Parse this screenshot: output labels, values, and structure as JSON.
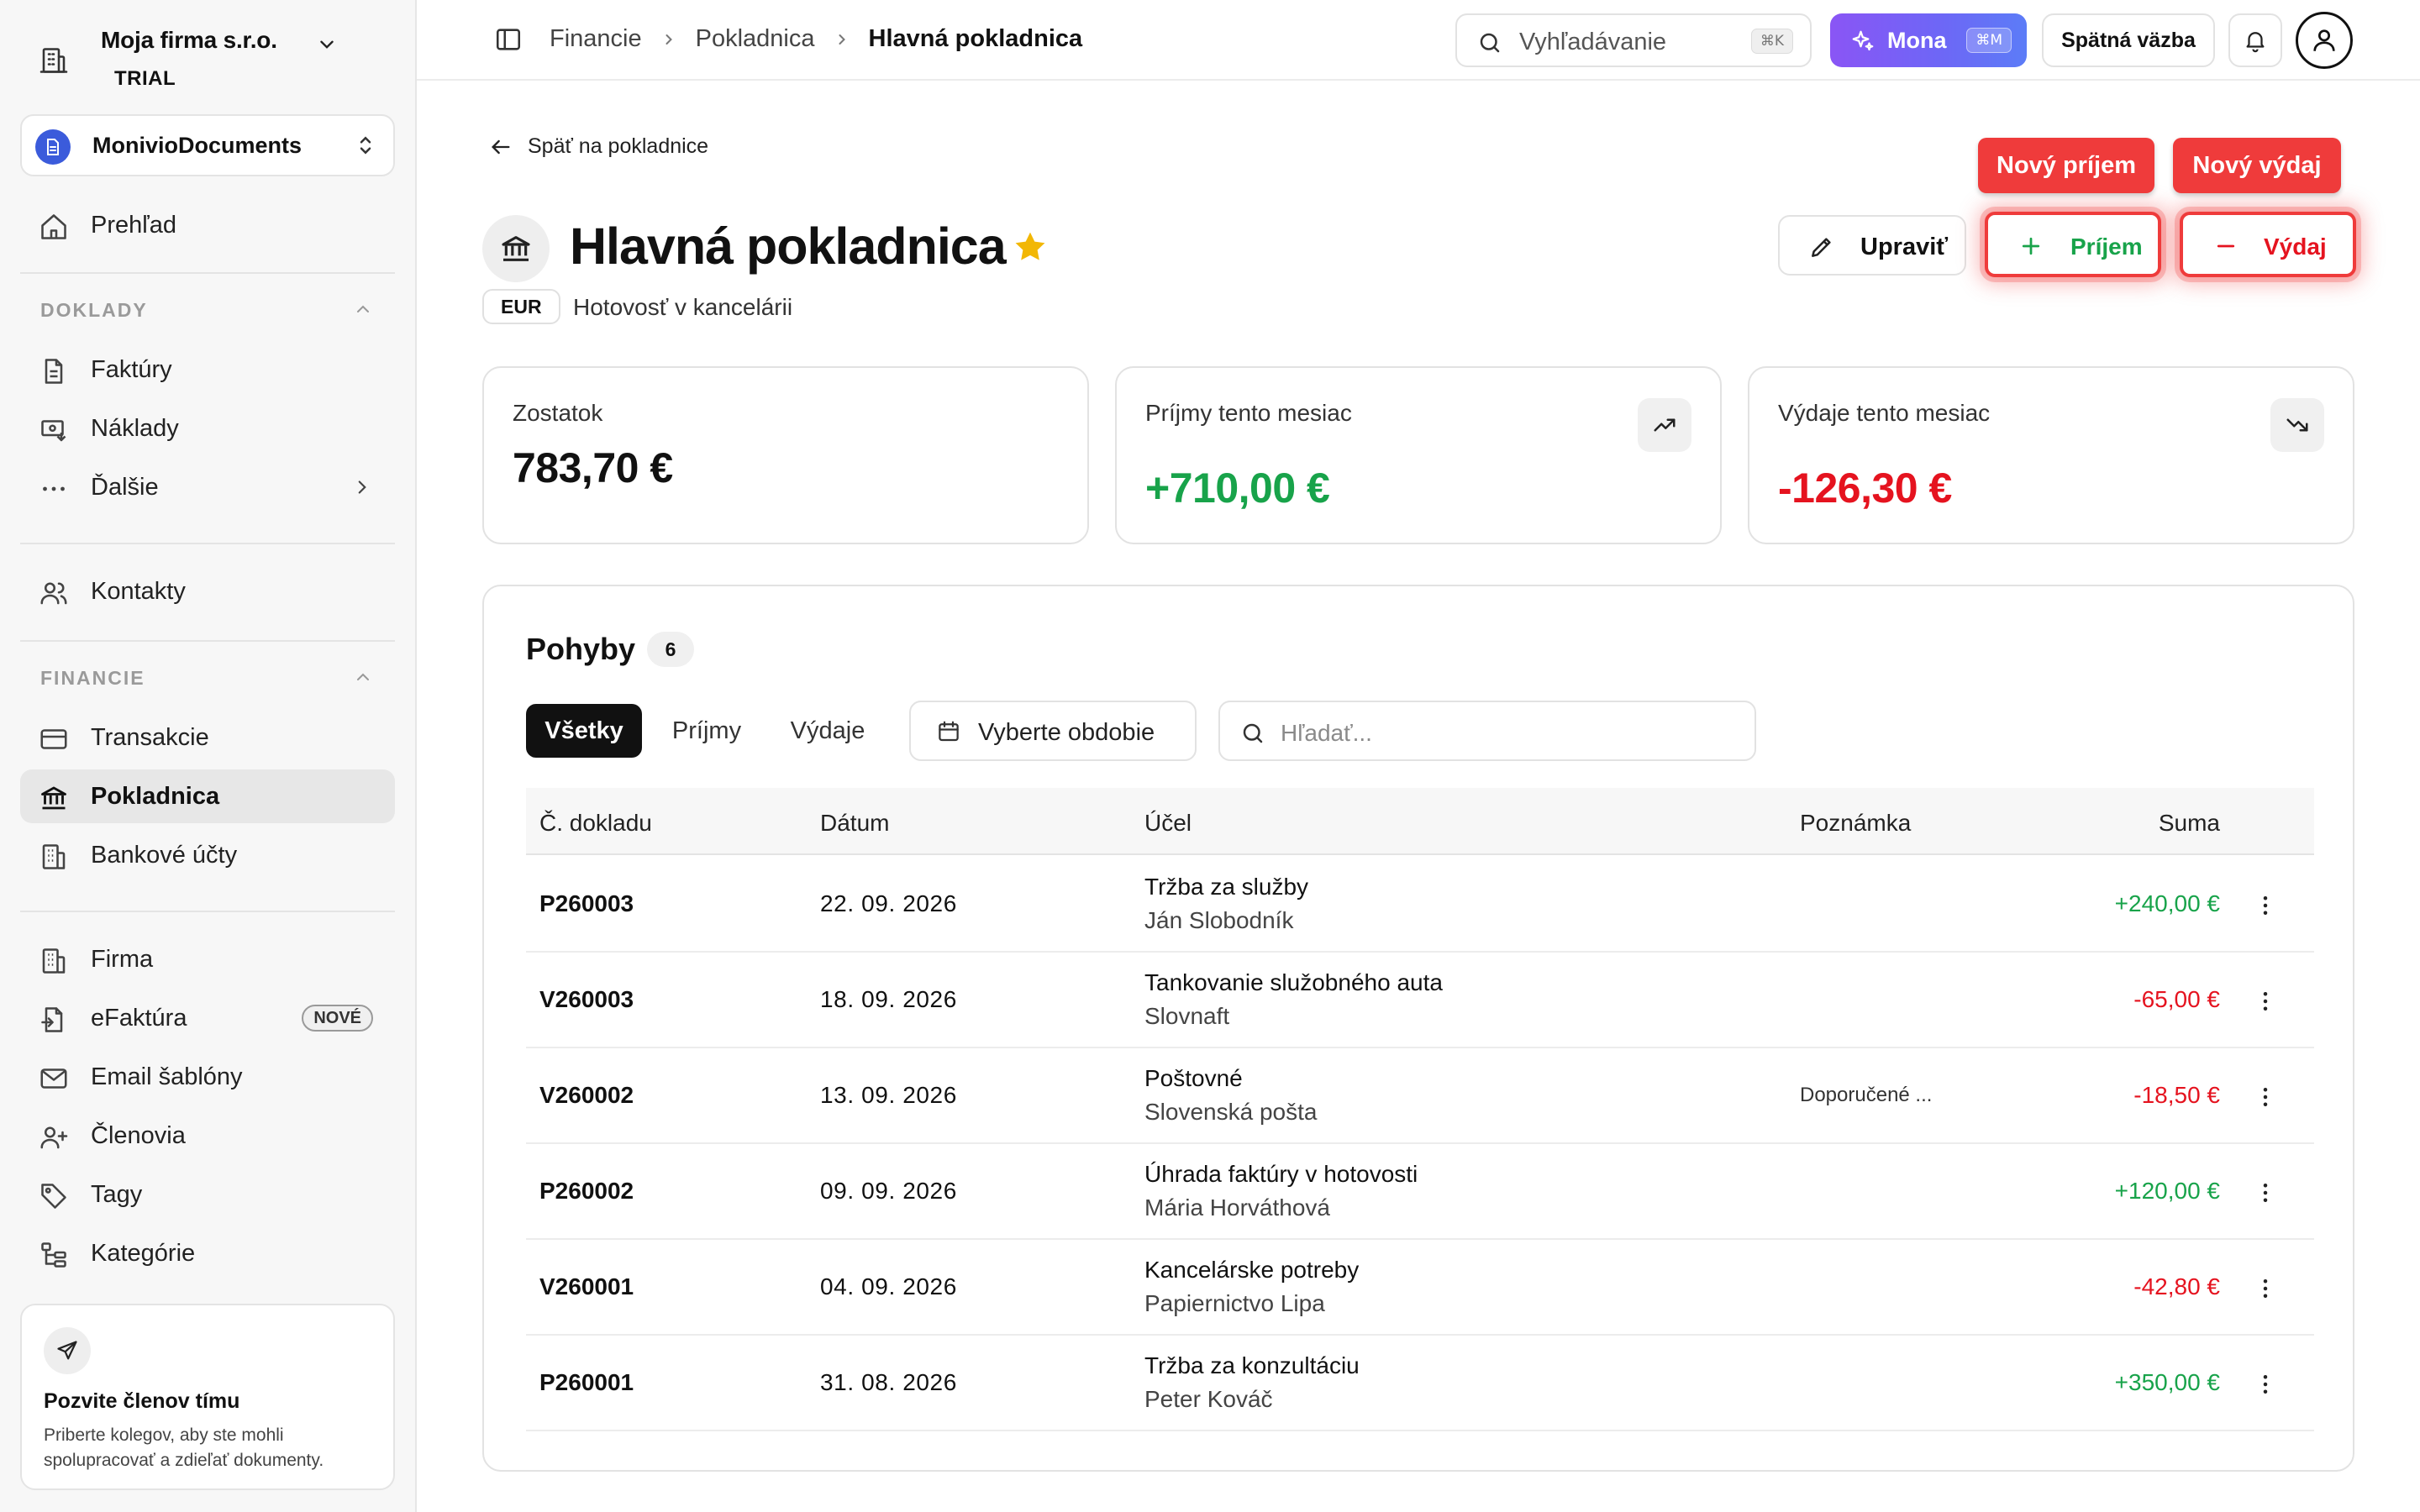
{
  "sidebar": {
    "company_name": "Moja firma s.r.o.",
    "company_plan": "TRIAL",
    "workspace": "MonivioDocuments",
    "overview": "Prehľad",
    "sections": {
      "doklady": "DOKLADY",
      "financie": "FINANCIE"
    },
    "items": {
      "faktury": "Faktúry",
      "naklady": "Náklady",
      "dalsie": "Ďalšie",
      "kontakty": "Kontakty",
      "transakcie": "Transakcie",
      "pokladnica": "Pokladnica",
      "bankove_ucty": "Bankové účty",
      "firma": "Firma",
      "efaktura": "eFaktúra",
      "efaktura_badge": "NOVÉ",
      "email_sablony": "Email šablóny",
      "clenovia": "Členovia",
      "tagy": "Tagy",
      "kategorie": "Kategórie"
    },
    "invite": {
      "title": "Pozvite členov tímu",
      "description": "Priberte kolegov, aby ste mohli spolupracovať a zdieľať dokumenty."
    }
  },
  "topbar": {
    "breadcrumbs": [
      "Financie",
      "Pokladnica",
      "Hlavná pokladnica"
    ],
    "search_placeholder": "Vyhľadávanie",
    "search_shortcut": "⌘K",
    "mona_label": "Mona",
    "mona_shortcut": "⌘M",
    "feedback_label": "Spätná väzba"
  },
  "page": {
    "back_label": "Späť na pokladnice",
    "title": "Hlavná pokladnica",
    "currency": "EUR",
    "description": "Hotovosť v kancelárii",
    "edit_label": "Upraviť",
    "income_label": "Príjem",
    "expense_label": "Výdaj",
    "tag_new_income": "Nový príjem",
    "tag_new_expense": "Nový výdaj",
    "colors": {
      "positive": "#18a34a",
      "negative": "#e5131f",
      "highlight": "#ef3b3b",
      "star": "#f2b705"
    }
  },
  "stats": {
    "balance_label": "Zostatok",
    "balance_value": "783,70 €",
    "income_label": "Príjmy tento mesiac",
    "income_value": "+710,00 €",
    "expense_label": "Výdaje tento mesiac",
    "expense_value": "-126,30 €"
  },
  "moves": {
    "title": "Pohyby",
    "count": "6",
    "tabs": [
      "Všetky",
      "Príjmy",
      "Výdaje"
    ],
    "period_label": "Vyberte obdobie",
    "search_placeholder": "Hľadať...",
    "columns": [
      "Č. dokladu",
      "Dátum",
      "Účel",
      "Poznámka",
      "Suma"
    ],
    "rows": [
      {
        "doc": "P260003",
        "date": "22. 09. 2026",
        "purpose": "Tržba za služby",
        "party": "Ján Slobodník",
        "note": "",
        "amount": "+240,00 €"
      },
      {
        "doc": "V260003",
        "date": "18. 09. 2026",
        "purpose": "Tankovanie služobného auta",
        "party": "Slovnaft",
        "note": "",
        "amount": "-65,00 €"
      },
      {
        "doc": "V260002",
        "date": "13. 09. 2026",
        "purpose": "Poštovné",
        "party": "Slovenská pošta",
        "note": "Doporučené ...",
        "amount": "-18,50 €"
      },
      {
        "doc": "P260002",
        "date": "09. 09. 2026",
        "purpose": "Úhrada faktúry v hotovosti",
        "party": "Mária Horváthová",
        "note": "",
        "amount": "+120,00 €"
      },
      {
        "doc": "V260001",
        "date": "04. 09. 2026",
        "purpose": "Kancelárske potreby",
        "party": "Papiernictvo Lipa",
        "note": "",
        "amount": "-42,80 €"
      },
      {
        "doc": "P260001",
        "date": "31. 08. 2026",
        "purpose": "Tržba za konzultáciu",
        "party": "Peter Kováč",
        "note": "",
        "amount": "+350,00 €"
      }
    ]
  }
}
